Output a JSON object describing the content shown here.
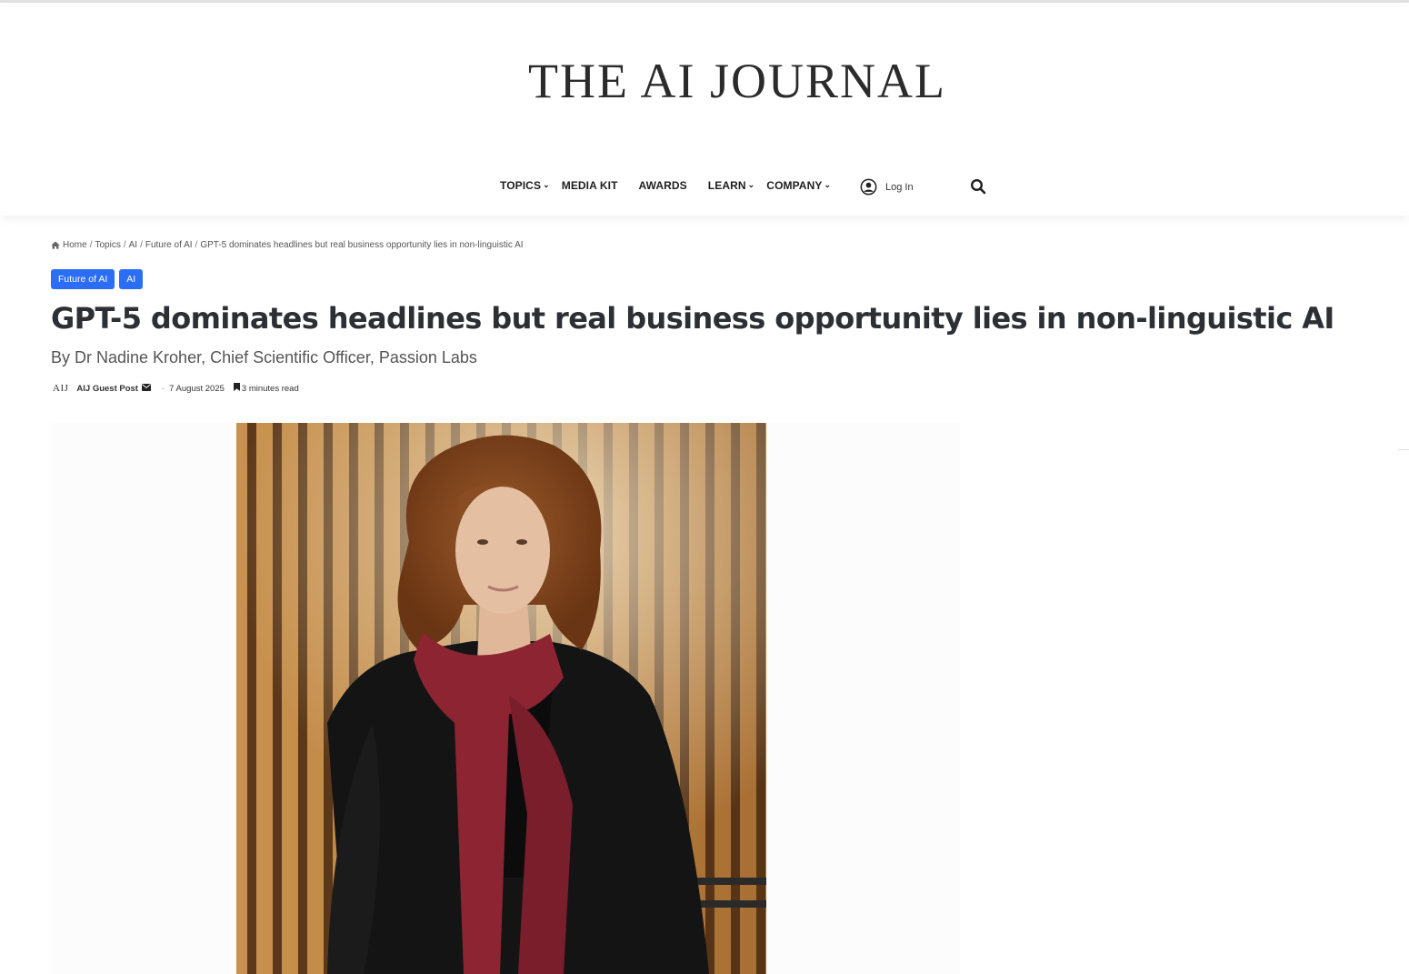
{
  "site": {
    "logo_text": "THE AI JOURNAL"
  },
  "nav": {
    "items": [
      {
        "label": "TOPICS",
        "has_dropdown": true
      },
      {
        "label": "MEDIA KIT",
        "has_dropdown": false
      },
      {
        "label": "AWARDS",
        "has_dropdown": false
      },
      {
        "label": "LEARN",
        "has_dropdown": true
      },
      {
        "label": "COMPANY",
        "has_dropdown": true
      }
    ],
    "login_label": "Log In",
    "search_icon": "search-icon",
    "user_icon": "user-circle-icon"
  },
  "breadcrumb": {
    "home_icon": "home-icon",
    "items": [
      "Home",
      "Topics",
      "AI",
      "Future of AI"
    ],
    "current": "GPT-5 dominates headlines but real business opportunity lies in non-linguistic AI"
  },
  "categories": [
    "Future of AI",
    "AI"
  ],
  "article": {
    "title": "GPT-5 dominates headlines but real business opportunity lies in non-linguistic AI",
    "subtitle": "By Dr Nadine Kroher, Chief Scientific Officer, Passion Labs",
    "avatar_text": "AIJ",
    "author": "AIJ Guest Post",
    "mail_icon": "envelope-icon",
    "date_separator": "-",
    "date": "7 August 2025",
    "bookmark_icon": "bookmark-icon",
    "read_time": "3 minutes read"
  },
  "colors": {
    "accent": "#2b6df4",
    "title_text": "#2c2f34",
    "photo_wood": "#b57c3e",
    "scarf": "#8c2432"
  }
}
